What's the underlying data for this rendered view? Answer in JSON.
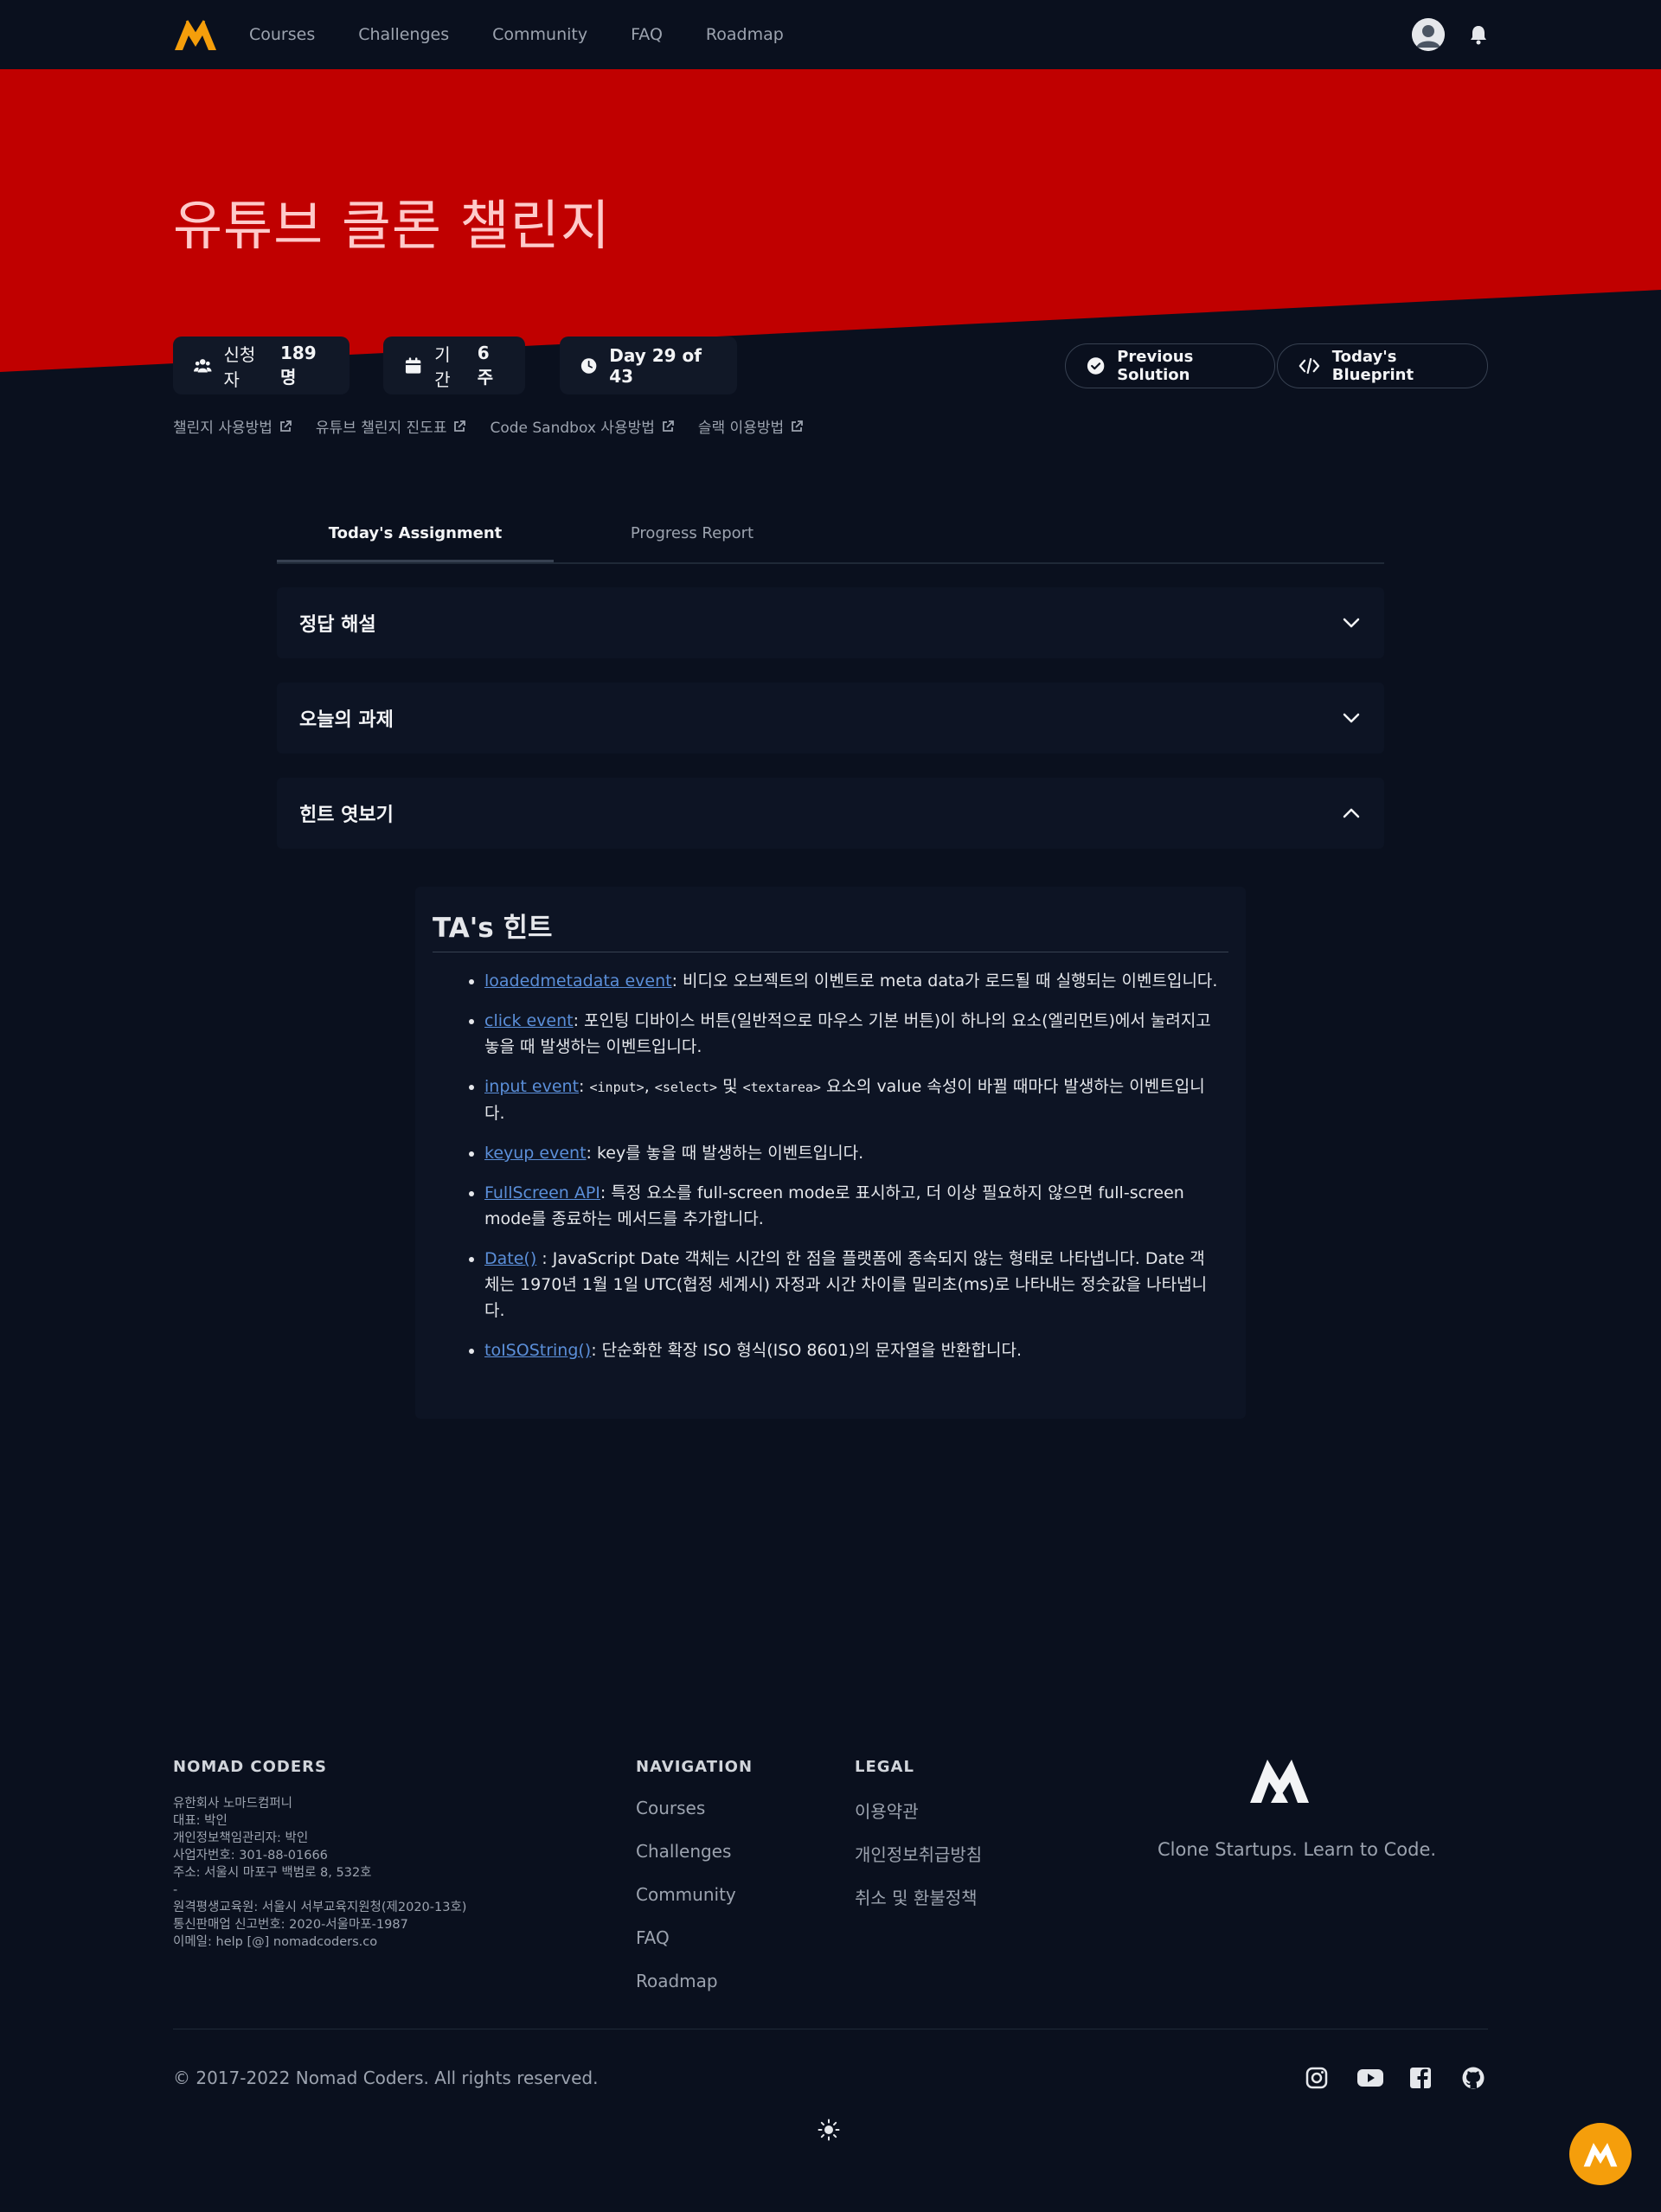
{
  "nav": {
    "links": [
      "Courses",
      "Challenges",
      "Community",
      "FAQ",
      "Roadmap"
    ]
  },
  "hero": {
    "title": "유튜브 클론 챌린지"
  },
  "stats": {
    "applicants_label": "신청자",
    "applicants_value": "189명",
    "duration_label": "기간",
    "duration_value": "6주",
    "day": "Day 29 of 43"
  },
  "actions": {
    "previous_solution": "Previous Solution",
    "todays_blueprint": "Today's Blueprint"
  },
  "helper_links": [
    "챌린지 사용방법",
    "유튜브 챌린지 진도표",
    "Code Sandbox 사용방법",
    "슬랙 이용방법"
  ],
  "tabs": [
    "Today's Assignment",
    "Progress Report"
  ],
  "accordions": [
    "정답 해설",
    "오늘의 과제",
    "힌트 엿보기"
  ],
  "hint": {
    "title": "TA's 힌트",
    "items": [
      {
        "link": "loadedmetadata event",
        "text": ": 비디오 오브젝트의 이벤트로 meta data가 로드될 때 실행되는 이벤트입니다."
      },
      {
        "link": "click event",
        "text": ": 포인팅 디바이스 버튼(일반적으로 마우스 기본 버튼)이 하나의 요소(엘리먼트)에서 눌려지고 놓을 때 발생하는 이벤트입니다."
      },
      {
        "link": "input event",
        "text_a": ": ",
        "code1": "<input>",
        "sep1": ", ",
        "code2": "<select>",
        "sep2": " 및 ",
        "code3": "<textarea>",
        "text_b": " 요소의 value 속성이 바뀔 때마다 발생하는 이벤트입니다."
      },
      {
        "link": "keyup event",
        "text": ": key를 놓을 때 발생하는 이벤트입니다."
      },
      {
        "link": "FullScreen API",
        "text": ": 특정 요소를 full-screen mode로 표시하고, 더 이상 필요하지 않으면 full-screen mode를 종료하는 메서드를 추가합니다."
      },
      {
        "link": "Date()",
        "text": " : JavaScript Date 객체는 시간의 한 점을 플랫폼에 종속되지 않는 형태로 나타냅니다. Date 객체는 1970년 1월 1일 UTC(협정 세계시) 자정과 시간 차이를 밀리초(ms)로 나타내는 정숫값을 나타냅니다."
      },
      {
        "link": "toISOString()",
        "text": ": 단순화한 확장 ISO 형식(ISO 8601)의 문자열을 반환합니다."
      }
    ]
  },
  "footer": {
    "company_heading": "NOMAD CODERS",
    "company_info": [
      "유한회사 노마드컴퍼니",
      "대표: 박인",
      "개인정보책임관리자: 박인",
      "사업자번호: 301-88-01666",
      "주소: 서울시 마포구 백범로 8, 532호",
      "-",
      "원격평생교육원: 서울시 서부교육지원청(제2020-13호)",
      "통신판매업 신고번호: 2020-서울마포-1987",
      "이메일: help [@] nomadcoders.co"
    ],
    "navigation_heading": "NAVIGATION",
    "navigation_links": [
      "Courses",
      "Challenges",
      "Community",
      "FAQ",
      "Roadmap"
    ],
    "legal_heading": "LEGAL",
    "legal_links": [
      "이용약관",
      "개인정보취급방침",
      "취소 및 환불정책"
    ],
    "tagline": "Clone Startups. Learn to Code.",
    "copyright": "© 2017-2022 Nomad Coders. All rights reserved."
  },
  "colors": {
    "hero_red": "#c00000",
    "background": "#0a101e",
    "accent_orange": "#f59e0b",
    "link_blue": "#5b8fd9"
  },
  "icons": [
    "logo-icon",
    "user-avatar-icon",
    "bell-icon",
    "users-icon",
    "calendar-icon",
    "clock-icon",
    "check-circle-icon",
    "code-icon",
    "external-link-icon",
    "chevron-down-icon",
    "chevron-up-icon",
    "instagram-icon",
    "youtube-icon",
    "facebook-icon",
    "github-icon",
    "sun-icon"
  ]
}
